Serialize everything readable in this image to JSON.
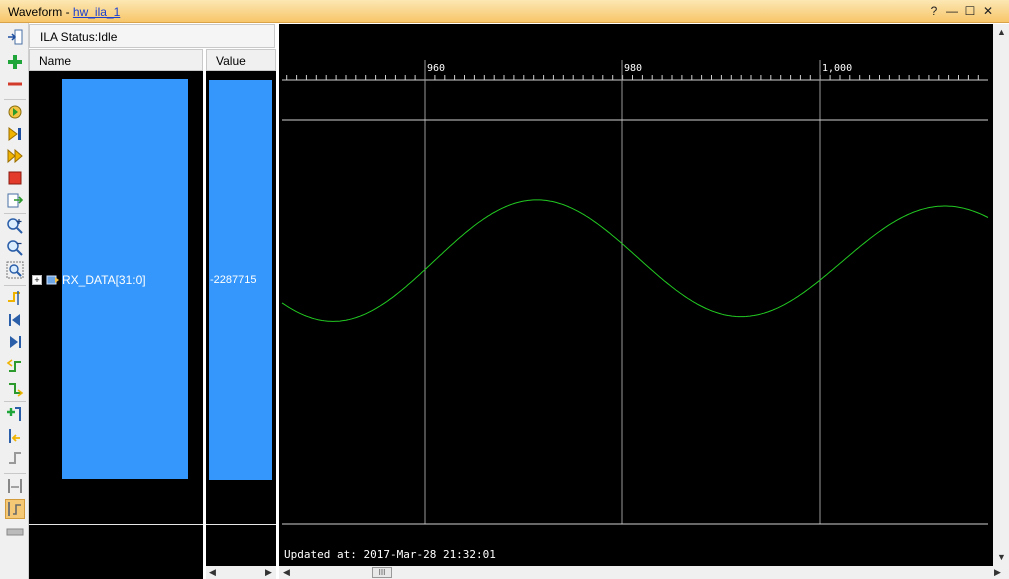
{
  "window": {
    "title_prefix": "Waveform - ",
    "title_link": "hw_ila_1",
    "help_label": "?",
    "minimize_label": "—",
    "maximize_label": "☐",
    "close_label": "✕"
  },
  "status": {
    "text": "ILA Status:Idle"
  },
  "columns": {
    "name_header": "Name",
    "value_header": "Value"
  },
  "signal": {
    "name": "RX_DATA[31:0]",
    "value": "-2287715",
    "expand_label": "+"
  },
  "timeline": {
    "ticks": [
      "960",
      "980",
      "1,000"
    ]
  },
  "footer": {
    "updated": "Updated at:  2017-Mar-28 21:32:01"
  },
  "scroll": {
    "thumb_label": "III"
  },
  "colors": {
    "signal_highlight": "#3597fb",
    "waveform": "#22c922",
    "background": "#000000",
    "titlebar": "#f7c66a"
  }
}
